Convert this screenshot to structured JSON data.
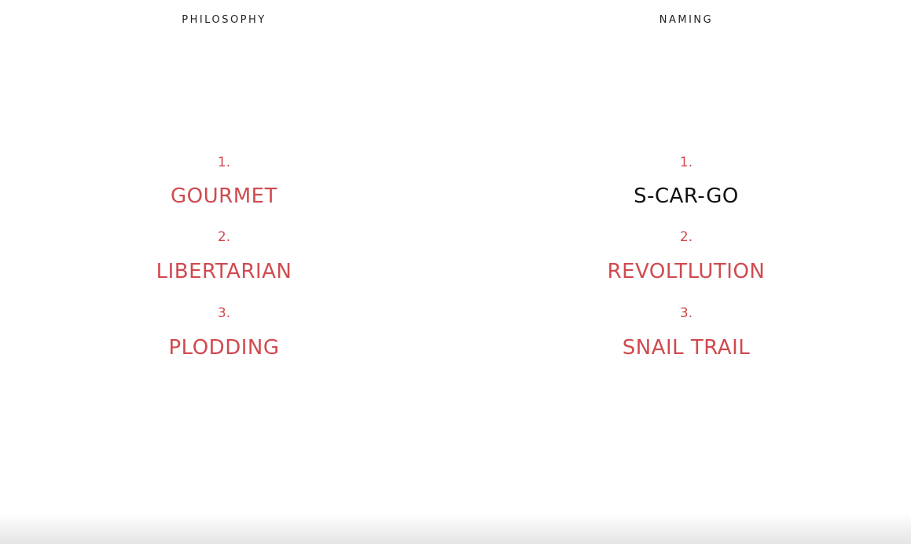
{
  "colors": {
    "accent": "#d04a4f",
    "highlight_text": "#111111",
    "heading_text": "#222222",
    "background": "#ffffff"
  },
  "philosophy": {
    "heading": "PHILOSOPHY",
    "items": [
      {
        "number": "1.",
        "label": "GOURMET"
      },
      {
        "number": "2.",
        "label": "LIBERTARIAN"
      },
      {
        "number": "3.",
        "label": "PLODDING"
      }
    ]
  },
  "naming": {
    "heading": "NAMING",
    "items": [
      {
        "number": "1.",
        "label": "S-CAR-GO"
      },
      {
        "number": "2.",
        "label": "REVOLTLUTION"
      },
      {
        "number": "3.",
        "label": "SNAIL TRAIL"
      }
    ]
  }
}
